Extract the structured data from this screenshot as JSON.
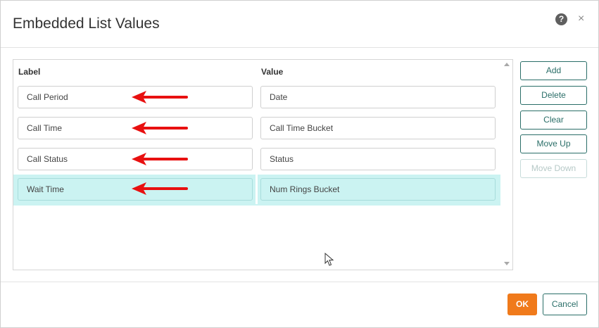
{
  "dialog": {
    "title": "Embedded List Values",
    "help_icon": "question-circle-icon",
    "help_glyph": "?",
    "close_icon": "close-icon",
    "close_glyph": "×"
  },
  "list": {
    "columns": {
      "label": "Label",
      "value": "Value"
    },
    "rows": [
      {
        "label": "Call Period",
        "value": "Date",
        "selected": false
      },
      {
        "label": "Call Time",
        "value": "Call Time Bucket",
        "selected": false
      },
      {
        "label": "Call Status",
        "value": "Status",
        "selected": false
      },
      {
        "label": "Wait Time",
        "value": "Num Rings Bucket",
        "selected": true
      }
    ]
  },
  "actions": {
    "add": "Add",
    "delete": "Delete",
    "clear": "Clear",
    "move_up": "Move Up",
    "move_down": "Move Down"
  },
  "footer": {
    "ok": "OK",
    "cancel": "Cancel"
  },
  "colors": {
    "accent": "#2a6e68",
    "ok_button": "#f07a1b",
    "selected_row": "#cbf3f2",
    "annotation_arrow": "#e81010"
  }
}
